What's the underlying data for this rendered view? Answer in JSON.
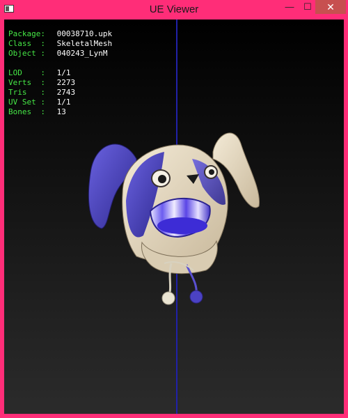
{
  "window": {
    "title": "UE Viewer"
  },
  "controls": {
    "minimize": "—",
    "maximize": "☐",
    "close": "✕"
  },
  "info": {
    "package_label": "Package:",
    "package_value": "00038710.upk",
    "class_label": "Class  :",
    "class_value": "SkeletalMesh",
    "object_label": "Object :",
    "object_value": "040243_LynM",
    "lod_label": "LOD    :",
    "lod_value": "1/1",
    "verts_label": "Verts  :",
    "verts_value": "2273",
    "tris_label": "Tris   :",
    "tris_value": "2743",
    "uvset_label": "UV Set :",
    "uvset_value": "1/1",
    "bones_label": "Bones  :",
    "bones_value": "13"
  },
  "colors": {
    "frame": "#ff2d78",
    "label": "#46e846",
    "value": "#ffffff",
    "axis": "#2121a8",
    "hat_blue": "#4b42c4",
    "hat_cream": "#e8dcc4"
  },
  "icons": {
    "app": "ue-viewer-app-icon",
    "minimize": "minimize-icon",
    "maximize": "maximize-icon",
    "close": "close-icon"
  }
}
